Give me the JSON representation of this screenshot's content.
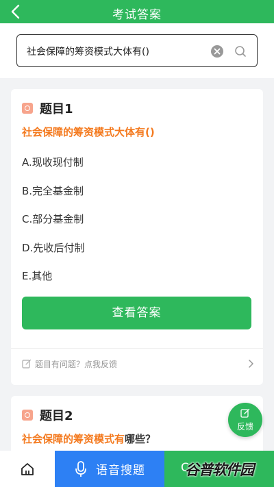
{
  "header": {
    "title": "考试答案",
    "back_icon": "chevron-left-icon"
  },
  "search": {
    "value": "社会保障的筹资模式大体有()",
    "clear_icon": "clear-circle-icon",
    "search_icon": "search-icon"
  },
  "questions": [
    {
      "number_label": "题目1",
      "text_highlight": "社会保障的筹资模式大体有()",
      "text_rest": "",
      "options": [
        "A.现收现付制",
        "B.完全基金制",
        "C.部分基金制",
        "D.先收后付制",
        "E.其他"
      ],
      "answer_button": "查看答案",
      "feedback_text": "题目有问题？点我反馈"
    },
    {
      "number_label": "题目2",
      "text_highlight": "社会保障的筹资模式有",
      "text_rest": "哪些？"
    }
  ],
  "floating_feedback": {
    "label": "反馈",
    "icon": "edit-icon"
  },
  "bottom_bar": {
    "home_icon": "home-icon",
    "voice_label": "语音搜题",
    "voice_icon": "microphone-icon",
    "photo_label_partial": "C"
  },
  "watermark": {
    "text": "谷普软件园"
  },
  "colors": {
    "primary_green": "#2eb85c",
    "blue": "#2d80f4",
    "highlight_orange": "#f47a1f"
  }
}
